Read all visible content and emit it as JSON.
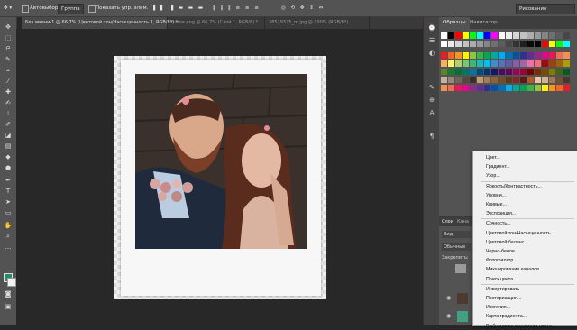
{
  "options": {
    "autoselect_label": "Автовыбор:",
    "autoselect_value": "Группа",
    "show_transform_label": "Показать упр. элем.",
    "workspace": "Рисование"
  },
  "tabs": [
    {
      "label": "Без имени-1 @ 66,7% (Цветовой тон/Насыщенность 1, RGB/8*) *"
    },
    {
      "label": "frame.png @ 66,7% (Слой 1, RGB/8) *"
    },
    {
      "label": "38529325_m.jpg @ 100% (RGB/8*)"
    }
  ],
  "panel_tabs": [
    "Образцы",
    "Навигатор"
  ],
  "layers_panel": {
    "tabs": [
      "Слои",
      "Кана"
    ],
    "filter": "Вид",
    "blend_mode": "Обычные",
    "lock_label": "Закрепить:"
  },
  "swatch_colors": {
    "top": [
      "#ffffff",
      "#000000",
      "#ff0000",
      "#ffff00",
      "#00ff00",
      "#00ffff",
      "#0000ff",
      "#ff00ff"
    ],
    "greys": [
      "#ffffff",
      "#ebebeb",
      "#d6d6d6",
      "#c2c2c2",
      "#adadad",
      "#999999",
      "#858585",
      "#707070",
      "#5c5c5c",
      "#474747",
      "#333333",
      "#1f1f1f",
      "#0a0a0a",
      "#000000"
    ],
    "row_a": [
      "#ed1c24",
      "#f26522",
      "#f7941d",
      "#fff200",
      "#8dc63f",
      "#39b54a",
      "#00a651",
      "#00a99d",
      "#00aeef",
      "#0072bc",
      "#0054a6",
      "#2e3192",
      "#662d91",
      "#92278f",
      "#ec008c",
      "#ed145b",
      "#f26c4f",
      "#f68e56"
    ],
    "row_b": [
      "#fbaf5d",
      "#fff568",
      "#acd373",
      "#7cc576",
      "#3bb878",
      "#1abbb4",
      "#00bff3",
      "#438ccb",
      "#5574b9",
      "#605ca8",
      "#855fa8",
      "#a763a8",
      "#f06eaa",
      "#f26d7d",
      "#9e0b0f",
      "#a0410d",
      "#a3620a",
      "#aba000"
    ],
    "row_c": [
      "#598527",
      "#197b30",
      "#007236",
      "#00746b",
      "#0076a3",
      "#004a80",
      "#003471",
      "#1b1464",
      "#440e62",
      "#630460",
      "#9e005d",
      "#9e0039",
      "#790000",
      "#7b2e00",
      "#7d4900",
      "#827b00",
      "#406618",
      "#005e20"
    ],
    "row_d": [
      "#c7b299",
      "#998675",
      "#736357",
      "#534741",
      "#37302d",
      "#c69c6d",
      "#a67c52",
      "#8c6239",
      "#754c24",
      "#603913",
      "#8b2323",
      "#5c1a1a",
      "#b15928",
      "#e6c7a0",
      "#d2b48c",
      "#9c7a57",
      "#6e5038",
      "#4a3728"
    ]
  },
  "menu": {
    "items": [
      {
        "label": "Цвет..."
      },
      {
        "label": "Градиент..."
      },
      {
        "label": "Узор..."
      },
      {
        "label": "Яркость/Контрастность..."
      },
      {
        "label": "Уровни..."
      },
      {
        "label": "Кривые..."
      },
      {
        "label": "Экспозиция..."
      },
      {
        "label": "Сочность..."
      },
      {
        "label": "Цветовой тон/Насыщенность..."
      },
      {
        "label": "Цветовой баланс..."
      },
      {
        "label": "Черно-белое..."
      },
      {
        "label": "Фотофильтр..."
      },
      {
        "label": "Микширование каналов..."
      },
      {
        "label": "Поиск цвета..."
      },
      {
        "label": "Инвертировать"
      },
      {
        "label": "Постеризация..."
      },
      {
        "label": "Изогелия..."
      },
      {
        "label": "Карта градиента..."
      },
      {
        "label": "Выборочная коррекция цвета..."
      }
    ]
  }
}
